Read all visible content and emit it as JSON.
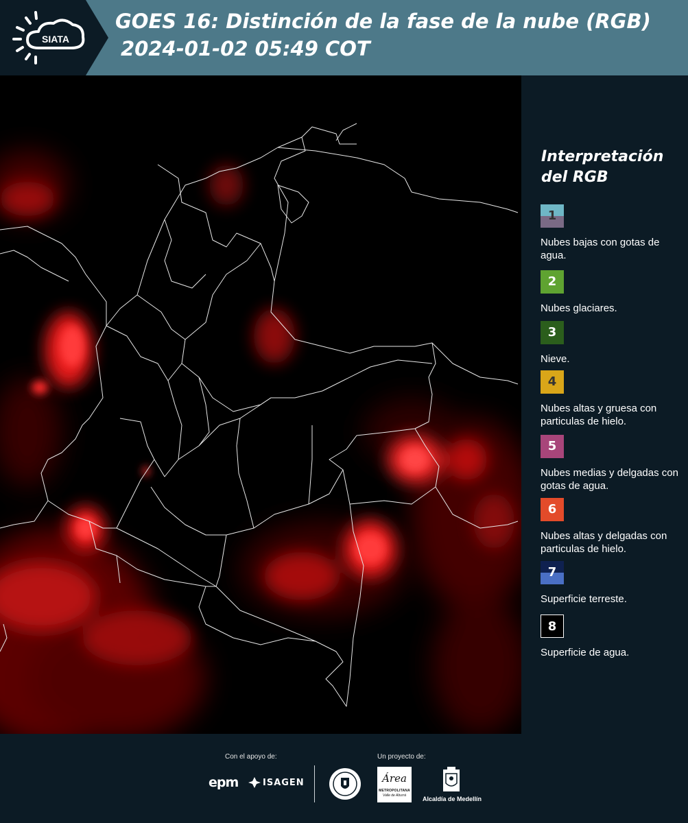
{
  "header": {
    "logo_text": "SIATA",
    "title_line1": "GOES 16: Distinción de la fase de la nube (RGB)",
    "title_line2": "2024-01-02 05:49 COT"
  },
  "legend": {
    "title": "Interpretación del RGB",
    "items": [
      {
        "number": "1",
        "label": "Nubes bajas con gotas de agua.",
        "color_top": "#6fb7c6",
        "color_bottom": "#7a6a85",
        "num_color": "#333333"
      },
      {
        "number": "2",
        "label": "Nubes glaciares.",
        "color_top": "#5fa331",
        "color_bottom": "#5fa331",
        "num_color": "#ffffff"
      },
      {
        "number": "3",
        "label": "Nieve.",
        "color_top": "#2b5e1c",
        "color_bottom": "#2b5e1c",
        "num_color": "#ffffff"
      },
      {
        "number": "4",
        "label": "Nubes altas y gruesa con particulas de hielo.",
        "color_top": "#d9a619",
        "color_bottom": "#d9a619",
        "num_color": "#333333"
      },
      {
        "number": "5",
        "label": "Nubes medias y delgadas con gotas de agua.",
        "color_top": "#a8457a",
        "color_bottom": "#a8457a",
        "num_color": "#ffffff"
      },
      {
        "number": "6",
        "label": "Nubes altas y delgadas con particulas de hielo.",
        "color_top": "#e34b2a",
        "color_bottom": "#e34b2a",
        "num_color": "#ffffff"
      },
      {
        "number": "7",
        "label": "Superficie terreste.",
        "color_top": "#0f2150",
        "color_bottom": "#4a6fc4",
        "num_color": "#ffffff"
      },
      {
        "number": "8",
        "label": "Superficie de agua.",
        "color_top": "#000000",
        "color_bottom": "#000000",
        "num_color": "#ffffff"
      }
    ]
  },
  "footer": {
    "support_label": "Con el apoyo de:",
    "project_label": "Un proyecto de:",
    "sponsor1": "epm",
    "sponsor2": "ISAGEN",
    "partner_area_name": "Área",
    "partner_area_line1": "METROPOLITANA",
    "partner_area_line2": "Valle de Aburrá",
    "partner_alcaldia": "Alcaldía de Medellín"
  },
  "colors": {
    "header_bg": "#4d7989",
    "logo_bg": "#0c1b25",
    "panel_bg": "#0c1b25",
    "cloud_red": "#ff1a1a"
  }
}
